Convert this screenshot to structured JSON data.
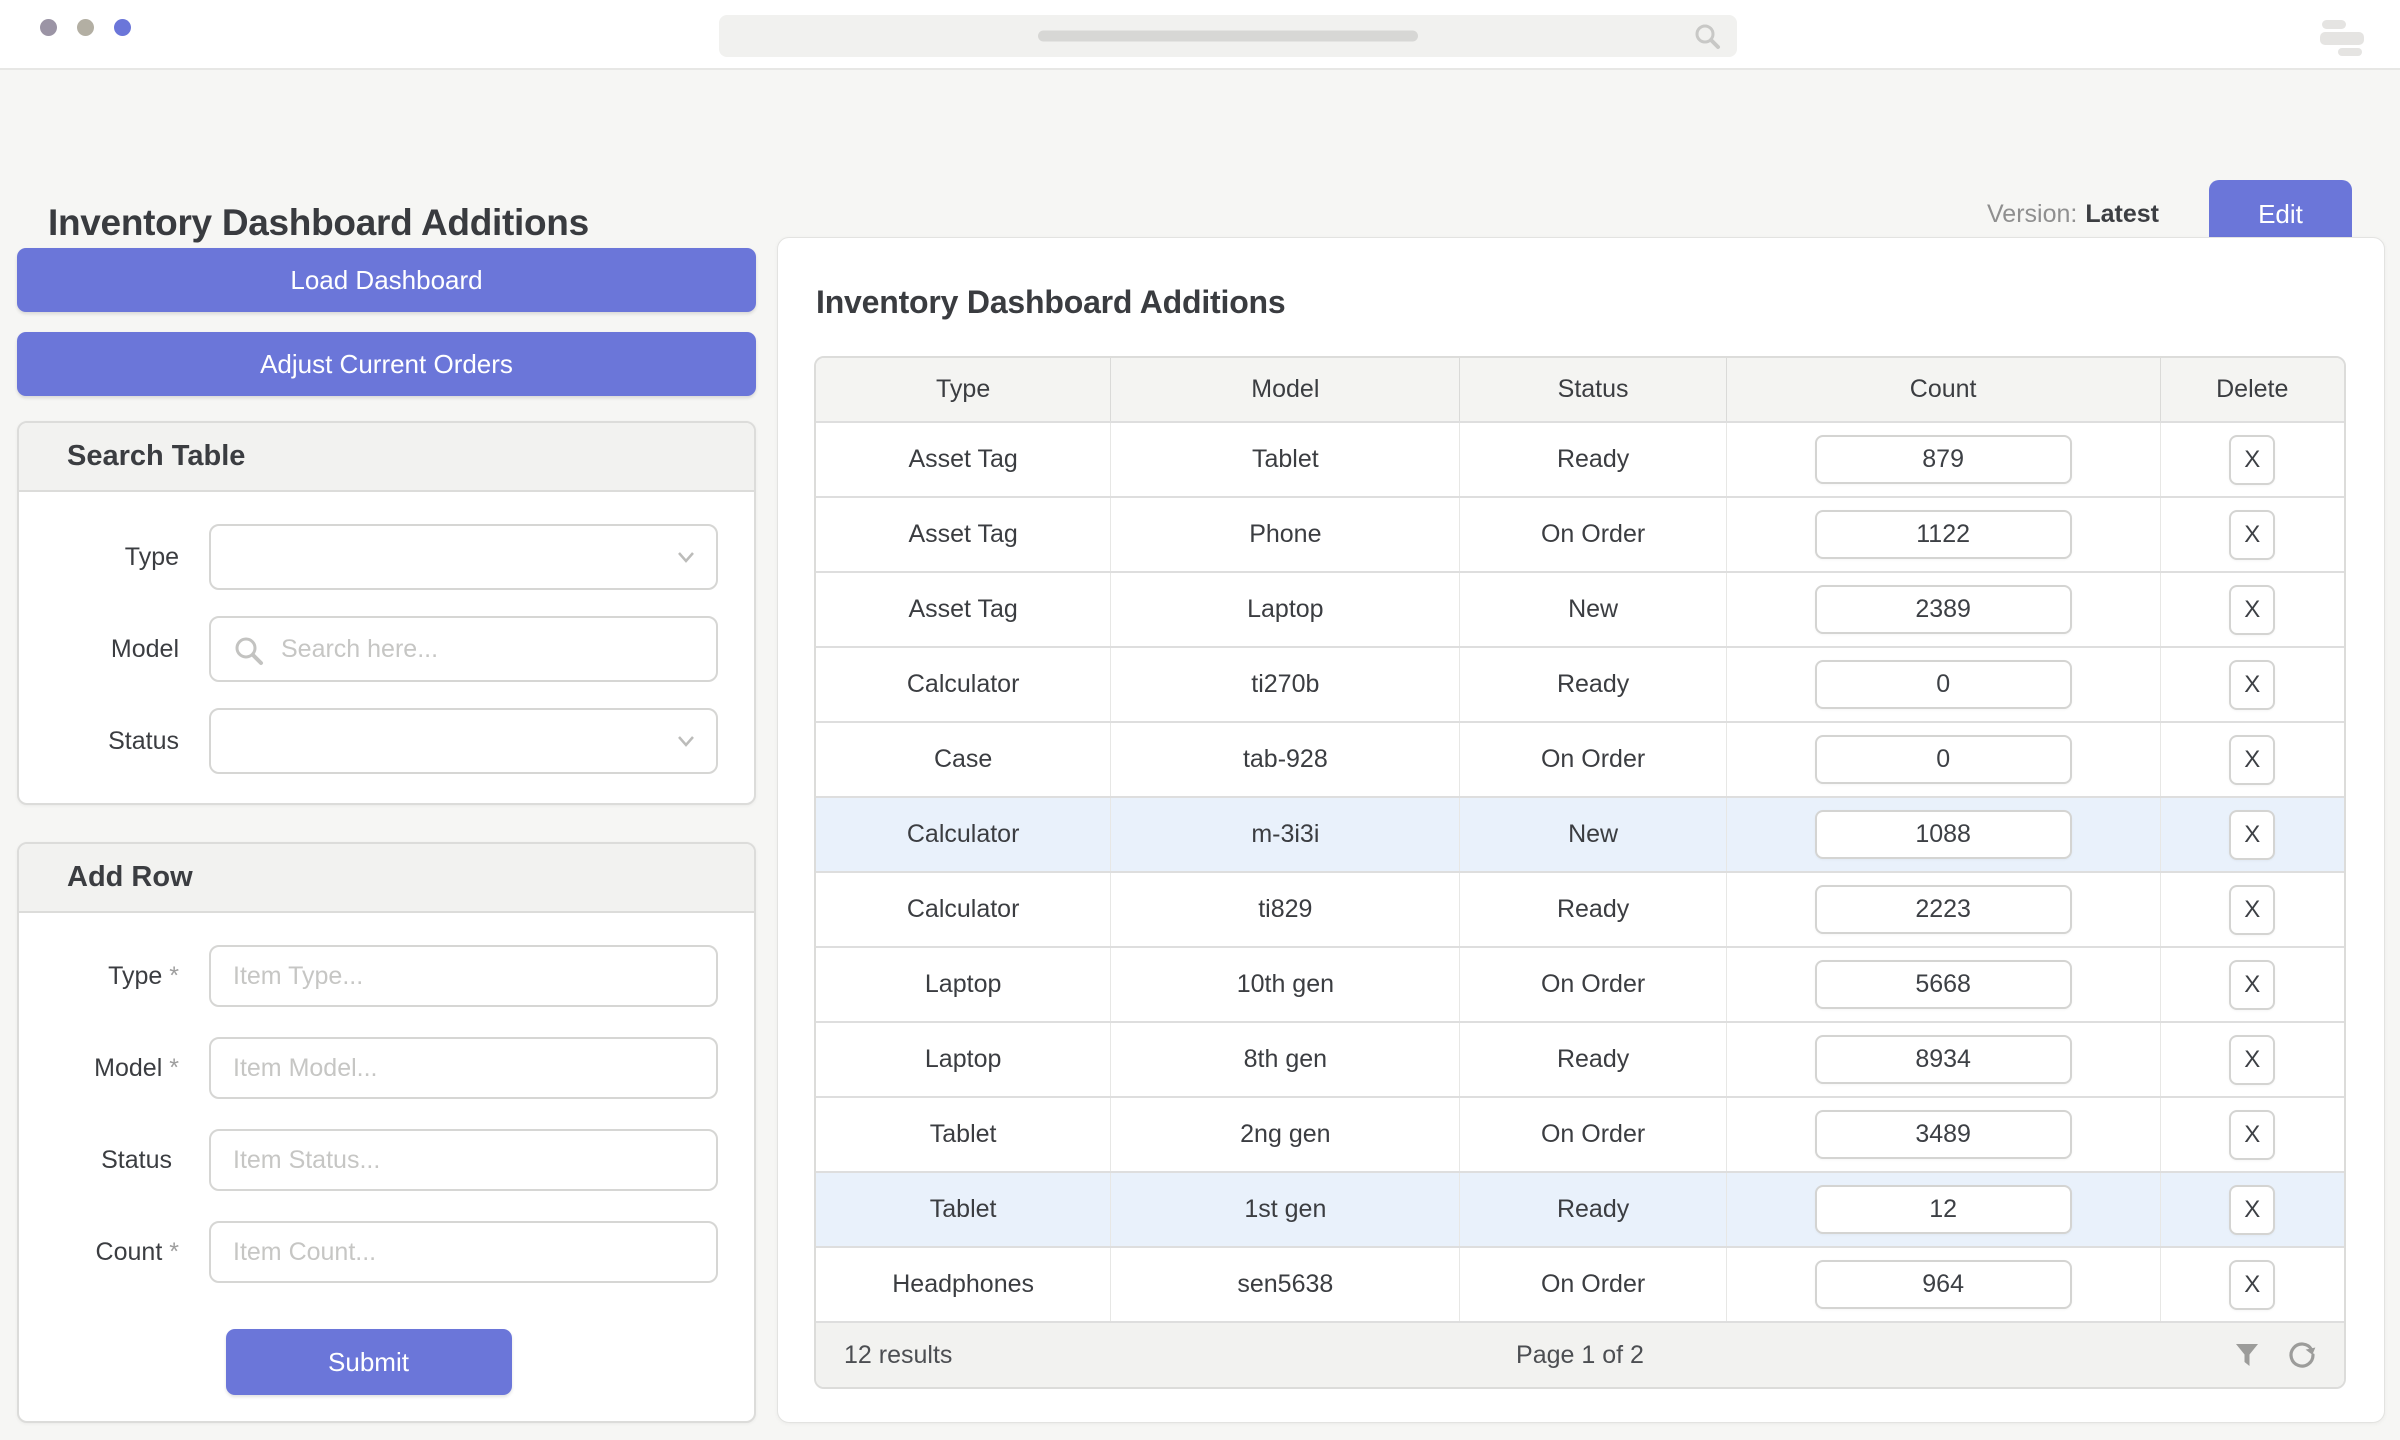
{
  "topbar": {
    "window_dots": [
      "#9b94a5",
      "#b3afa3",
      "#6b76d9"
    ]
  },
  "header": {
    "title": "Inventory Dashboard Additions",
    "version_label": "Version:",
    "version_value": "Latest",
    "edit_button": "Edit"
  },
  "sidebar": {
    "load_button": "Load Dashboard",
    "adjust_button": "Adjust Current Orders",
    "search_panel": {
      "title": "Search Table",
      "fields": [
        {
          "label": "Type",
          "control": "select"
        },
        {
          "label": "Model",
          "control": "search",
          "placeholder": "Search here..."
        },
        {
          "label": "Status",
          "control": "select"
        }
      ]
    },
    "add_panel": {
      "title": "Add Row",
      "fields": [
        {
          "label": "Type",
          "req": "*",
          "placeholder": "Item Type..."
        },
        {
          "label": "Model",
          "req": "*",
          "placeholder": "Item Model..."
        },
        {
          "label": "Status",
          "placeholder": "Item Status..."
        },
        {
          "label": "Count",
          "req": "*",
          "placeholder": "Item Count..."
        }
      ],
      "submit_button": "Submit"
    }
  },
  "main": {
    "title": "Inventory Dashboard Additions",
    "table": {
      "columns": [
        "Type",
        "Model",
        "Status",
        "Count",
        "Delete"
      ],
      "delete_label": "X",
      "rows": [
        {
          "type": "Asset Tag",
          "model": "Tablet",
          "status": "Ready",
          "count": "879",
          "highlighted": false
        },
        {
          "type": "Asset Tag",
          "model": "Phone",
          "status": "On Order",
          "count": "1122",
          "highlighted": false
        },
        {
          "type": "Asset Tag",
          "model": "Laptop",
          "status": "New",
          "count": "2389",
          "highlighted": false
        },
        {
          "type": "Calculator",
          "model": "ti270b",
          "status": "Ready",
          "count": "0",
          "highlighted": false
        },
        {
          "type": "Case",
          "model": "tab-928",
          "status": "On Order",
          "count": "0",
          "highlighted": false
        },
        {
          "type": "Calculator",
          "model": "m-3i3i",
          "status": "New",
          "count": "1088",
          "highlighted": true
        },
        {
          "type": "Calculator",
          "model": "ti829",
          "status": "Ready",
          "count": "2223",
          "highlighted": false
        },
        {
          "type": "Laptop",
          "model": "10th gen",
          "status": "On Order",
          "count": "5668",
          "highlighted": false
        },
        {
          "type": "Laptop",
          "model": "8th gen",
          "status": "Ready",
          "count": "8934",
          "highlighted": false
        },
        {
          "type": "Tablet",
          "model": "2ng gen",
          "status": "On Order",
          "count": "3489",
          "highlighted": false
        },
        {
          "type": "Tablet",
          "model": "1st gen",
          "status": "Ready",
          "count": "12",
          "highlighted": true
        },
        {
          "type": "Headphones",
          "model": "sen5638",
          "status": "On Order",
          "count": "964",
          "highlighted": false
        }
      ],
      "footer": {
        "results": "12 results",
        "page": "Page 1 of 2"
      }
    }
  },
  "colors": {
    "accent": "#6b76d9",
    "row_highlight": "#e9f1fb",
    "panel_header_bg": "#f2f2f0",
    "page_bg": "#f6f6f4"
  }
}
